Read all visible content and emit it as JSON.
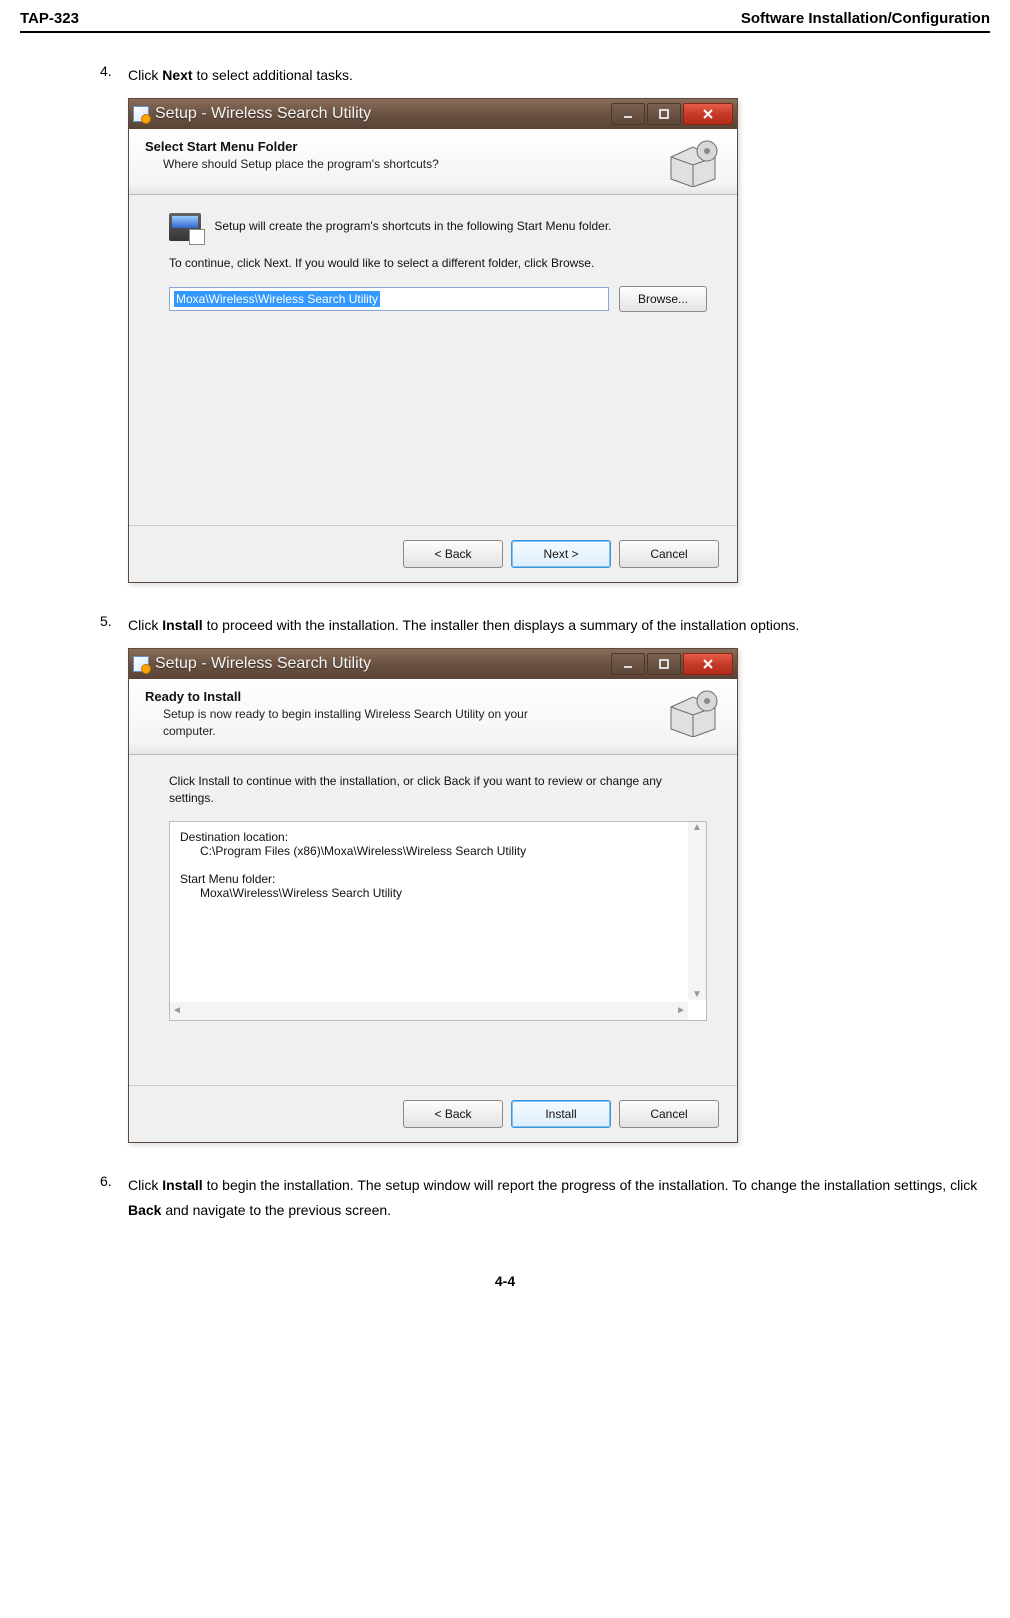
{
  "header": {
    "left": "TAP-323",
    "right": "Software Installation/Configuration"
  },
  "step4": {
    "num": "4.",
    "text_before": "Click ",
    "bold": "Next",
    "text_after": " to select additional tasks."
  },
  "win1": {
    "title": "Setup - Wireless Search Utility",
    "header_title": "Select Start Menu Folder",
    "header_sub": "Where should Setup place the program's shortcuts?",
    "body_line1": "Setup will create the program's shortcuts in the following Start Menu folder.",
    "body_line2": "To continue, click Next. If you would like to select a different folder, click Browse.",
    "path_value": "Moxa\\Wireless\\Wireless Search Utility",
    "browse": "Browse...",
    "back": "< Back",
    "next": "Next >",
    "cancel": "Cancel"
  },
  "step5": {
    "num": "5.",
    "text_before": "Click ",
    "bold": "Install",
    "text_after": " to proceed with the installation. The installer then displays a summary of the installation options."
  },
  "win2": {
    "title": "Setup - Wireless Search Utility",
    "header_title": "Ready to Install",
    "header_sub": "Setup is now ready to begin installing Wireless Search Utility on your computer.",
    "body_line1": "Click Install to continue with the installation, or click Back if you want to review or change any settings.",
    "summary": "Destination location:\n      C:\\Program Files (x86)\\Moxa\\Wireless\\Wireless Search Utility\n\nStart Menu folder:\n      Moxa\\Wireless\\Wireless Search Utility",
    "back": "< Back",
    "install": "Install",
    "cancel": "Cancel"
  },
  "step6": {
    "num": "6.",
    "text_before": "Click ",
    "bold1": "Install",
    "mid": " to begin the installation. The setup window will report the progress of the installation. To change the installation settings, click ",
    "bold2": "Back",
    "text_after": " and navigate to the previous screen."
  },
  "page_number": "4-4"
}
